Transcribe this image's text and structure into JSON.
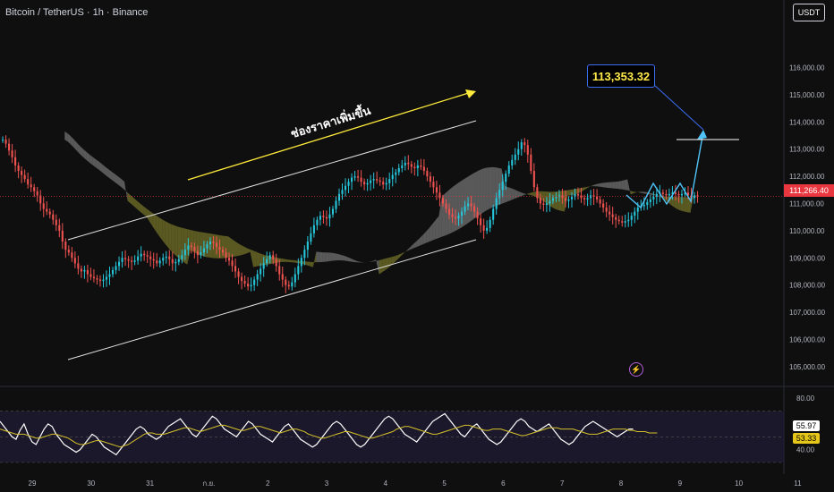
{
  "header": {
    "symbol_title": "Bitcoin / TetherUS · 1h · Binance",
    "currency_button": "USDT"
  },
  "annotations": {
    "channel_label": "ช่องราคาเพิ่มขึ้น",
    "target_callout": "113,353.32",
    "last_price_tag": "111,266.40",
    "rsi_value_white": "55.97",
    "rsi_value_yellow": "53.33",
    "alert_icon": "lightning-icon"
  },
  "colors": {
    "background": "#0f0f10",
    "bull": "#26c6da",
    "bear": "#ef5350",
    "cloud_bear": "#8a8a8a",
    "cloud_bull": "#8c8a2e",
    "trend_arrow": "#ffeb3b",
    "target_arrow": "#4fc3f7",
    "rsi_line": "#ffffff",
    "rsi_ma": "#d4c02a",
    "rsi_band": "#1e1a33",
    "price_tag": "#e8373f"
  },
  "chart_data": [
    {
      "type": "candlestick",
      "title": "",
      "ylim": [
        104500,
        117500
      ],
      "yticks": [
        "116,000.00",
        "115,000.00",
        "114,000.00",
        "113,000.00",
        "112,000.00",
        "111,000.00",
        "110,000.00",
        "109,000.00",
        "108,000.00",
        "107,000.00",
        "106,000.00",
        "105,000.00"
      ],
      "xticks": [
        "29",
        "30",
        "31",
        "ก.ย.",
        "2",
        "3",
        "4",
        "5",
        "6",
        "7",
        "8",
        "9",
        "10",
        "11"
      ],
      "closes": [
        113350,
        113200,
        112950,
        112700,
        112400,
        112200,
        112050,
        111900,
        111700,
        111600,
        111450,
        111300,
        111000,
        110800,
        110700,
        110600,
        110400,
        110200,
        110000,
        109600,
        109300,
        109200,
        109000,
        108800,
        108600,
        108500,
        108550,
        108400,
        108300,
        108250,
        108200,
        108150,
        108200,
        108300,
        108400,
        108550,
        108700,
        108850,
        109000,
        108950,
        108900,
        108850,
        108900,
        109050,
        109150,
        109100,
        109050,
        108950,
        108900,
        108800,
        108900,
        109000,
        109050,
        108950,
        108800,
        108850,
        108950,
        109100,
        109300,
        109450,
        109400,
        109250,
        109100,
        109200,
        109350,
        109500,
        109600,
        109550,
        109400,
        109300,
        109200,
        109000,
        108900,
        108700,
        108500,
        108300,
        108150,
        108050,
        107950,
        108000,
        108200,
        108400,
        108600,
        108800,
        108950,
        109100,
        108950,
        108700,
        108400,
        108200,
        108000,
        107950,
        108100,
        108400,
        108700,
        109000,
        109300,
        109600,
        109900,
        110200,
        110400,
        110550,
        110500,
        110450,
        110600,
        110800,
        111100,
        111350,
        111500,
        111650,
        111800,
        111950,
        112000,
        111950,
        111800,
        111700,
        111750,
        111850,
        111900,
        111850,
        111800,
        111700,
        111750,
        111900,
        112050,
        112150,
        112300,
        112400,
        112500,
        112450,
        112350,
        112300,
        112400,
        112350,
        112200,
        112000,
        111800,
        111600,
        111400,
        111200,
        111000,
        110800,
        110600,
        110500,
        110450,
        110550,
        110700,
        110900,
        111000,
        110900,
        110700,
        110450,
        110200,
        110000,
        110100,
        110400,
        110800,
        111200,
        111500,
        111800,
        112100,
        112400,
        112600,
        112800,
        113000,
        113250,
        113150,
        112800,
        112200,
        111600,
        111200,
        111000,
        110950,
        111000,
        111100,
        111200,
        111250,
        111300,
        111200,
        111100,
        111150,
        111250,
        111350,
        111300,
        111200,
        111150,
        111200,
        111300,
        111250,
        111150,
        111000,
        110850,
        110700,
        110600,
        110500,
        110400,
        110350,
        110300,
        110350,
        110400,
        110550,
        110700,
        110850,
        110900,
        110950,
        111050,
        111150,
        111250,
        111350,
        111400,
        111350,
        111300,
        111350,
        111400,
        111350,
        111300,
        111350,
        111400,
        111300,
        111200,
        111300,
        111266
      ],
      "ichimoku_cloud": "shown",
      "channel_lines": "upper and lower ascending",
      "projection_target": 113353.32,
      "last_price": 111266.4
    },
    {
      "type": "line",
      "title": "",
      "ylim": [
        30,
        85
      ],
      "yticks": [
        "80.00",
        "60.00",
        "40.00"
      ],
      "series": [
        {
          "values": [
            62,
            58,
            54,
            50,
            48,
            55,
            60,
            52,
            46,
            44,
            50,
            56,
            60,
            58,
            52,
            48,
            44,
            42,
            40,
            38,
            40,
            44,
            48,
            52,
            50,
            46,
            42,
            40,
            38,
            36,
            40,
            44,
            48,
            52,
            56,
            58,
            56,
            52,
            50,
            48,
            50,
            54,
            58,
            60,
            62,
            64,
            60,
            56,
            52,
            50,
            54,
            58,
            62,
            66,
            64,
            60,
            56,
            54,
            52,
            50,
            54,
            58,
            62,
            60,
            56,
            52,
            50,
            48,
            46,
            50,
            54,
            58,
            60,
            56,
            52,
            48,
            46,
            44,
            42,
            44,
            48,
            52,
            56,
            60,
            62,
            60,
            56,
            52,
            48,
            44,
            42,
            44,
            48,
            52,
            56,
            60,
            64,
            66,
            64,
            60,
            56,
            52,
            50,
            48,
            46,
            50,
            54,
            58,
            62,
            64,
            66,
            68,
            64,
            60,
            56,
            52,
            50,
            54,
            58,
            60,
            56,
            52,
            48,
            46,
            44,
            46,
            50,
            54,
            58,
            62,
            64,
            62,
            58,
            56,
            54,
            56,
            58,
            60,
            56,
            52,
            48,
            46,
            44,
            46,
            50,
            54,
            58,
            60,
            62,
            60,
            58,
            56,
            54,
            52,
            50,
            52,
            54,
            56,
            56
          ]
        },
        {
          "values": [
            56,
            55,
            54,
            53,
            52,
            52,
            52,
            51,
            50,
            49,
            49,
            50,
            51,
            52,
            52,
            51,
            50,
            49,
            47,
            45,
            44,
            44,
            45,
            46,
            47,
            47,
            46,
            45,
            44,
            43,
            42,
            43,
            44,
            46,
            48,
            50,
            52,
            53,
            53,
            52,
            52,
            52,
            53,
            54,
            55,
            56,
            57,
            57,
            56,
            55,
            54,
            55,
            56,
            57,
            58,
            59,
            59,
            58,
            57,
            56,
            55,
            55,
            56,
            57,
            58,
            58,
            57,
            56,
            55,
            54,
            53,
            54,
            55,
            56,
            56,
            55,
            54,
            52,
            51,
            50,
            49,
            49,
            50,
            51,
            52,
            53,
            54,
            54,
            53,
            52,
            51,
            50,
            49,
            49,
            50,
            51,
            52,
            53,
            54,
            56,
            57,
            58,
            58,
            57,
            56,
            55,
            54,
            53,
            52,
            52,
            53,
            54,
            55,
            56,
            57,
            58,
            59,
            59,
            58,
            57,
            56,
            55,
            55,
            56,
            56,
            56,
            55,
            54,
            53,
            52,
            51,
            51,
            52,
            53,
            54,
            55,
            56,
            57,
            57,
            57,
            56,
            56,
            56,
            56,
            55,
            54,
            53,
            52,
            52,
            52,
            53,
            54,
            55,
            56,
            56,
            56,
            56,
            55,
            55,
            54,
            54,
            54,
            53,
            53,
            53
          ]
        }
      ]
    }
  ]
}
